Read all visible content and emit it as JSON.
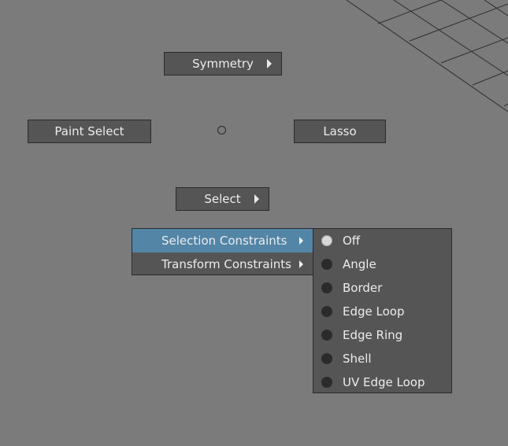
{
  "marking_menu": {
    "north": {
      "label": "Symmetry",
      "has_submenu": true
    },
    "west": {
      "label": "Paint Select"
    },
    "east": {
      "label": "Lasso"
    },
    "south": {
      "label": "Select",
      "has_submenu": true
    }
  },
  "context_menu": {
    "items": [
      {
        "label": "Selection Constraints",
        "has_submenu": true,
        "highlighted": true
      },
      {
        "label": "Transform Constraints",
        "has_submenu": true,
        "highlighted": false
      }
    ]
  },
  "constraints_submenu": {
    "selected": "Off",
    "options": [
      "Off",
      "Angle",
      "Border",
      "Edge Loop",
      "Edge Ring",
      "Shell",
      "UV Edge Loop"
    ]
  },
  "colors": {
    "viewport_bg": "#7b7b7b",
    "menu_bg": "#555555",
    "highlight": "#5285a6",
    "grid_line": "#2e2e2e"
  }
}
